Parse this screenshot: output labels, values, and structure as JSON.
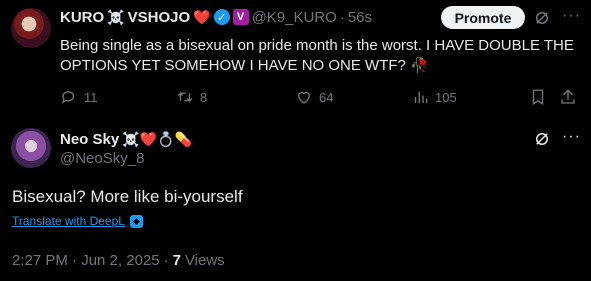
{
  "tweet": {
    "author_name": "KURO",
    "author_name_suffix": "VSHOJO",
    "emoji_skull": "☠️",
    "emoji_heart": "❤️",
    "handle": "@K9_KURO",
    "time_sep": "·",
    "time": "56s",
    "promote_label": "Promote",
    "more_label": "···",
    "text": "Being single as a bisexual on pride month is the worst. I HAVE DOUBLE THE OPTIONS YET SOMEHOW I HAVE NO ONE WTF? 🥀",
    "replies": "11",
    "retweets": "8",
    "likes": "64",
    "views": "105",
    "badge_letter": "V",
    "verified_mark": "✓"
  },
  "reply": {
    "author_name": "Neo Sky",
    "emojis": "☠️❤️💍💊",
    "handle": "@NeoSky_8",
    "text": "Bisexual? More like bi-yourself",
    "translate_label": "Translate with DeepL",
    "timestamp": "2:27 PM · Jun 2, 2025",
    "sep": "·",
    "views_count": "7",
    "views_label": "Views"
  },
  "colors": {
    "background": "#000000",
    "text": "#e7e9ea",
    "muted": "#71767b",
    "accent": "#1d9bf0"
  }
}
